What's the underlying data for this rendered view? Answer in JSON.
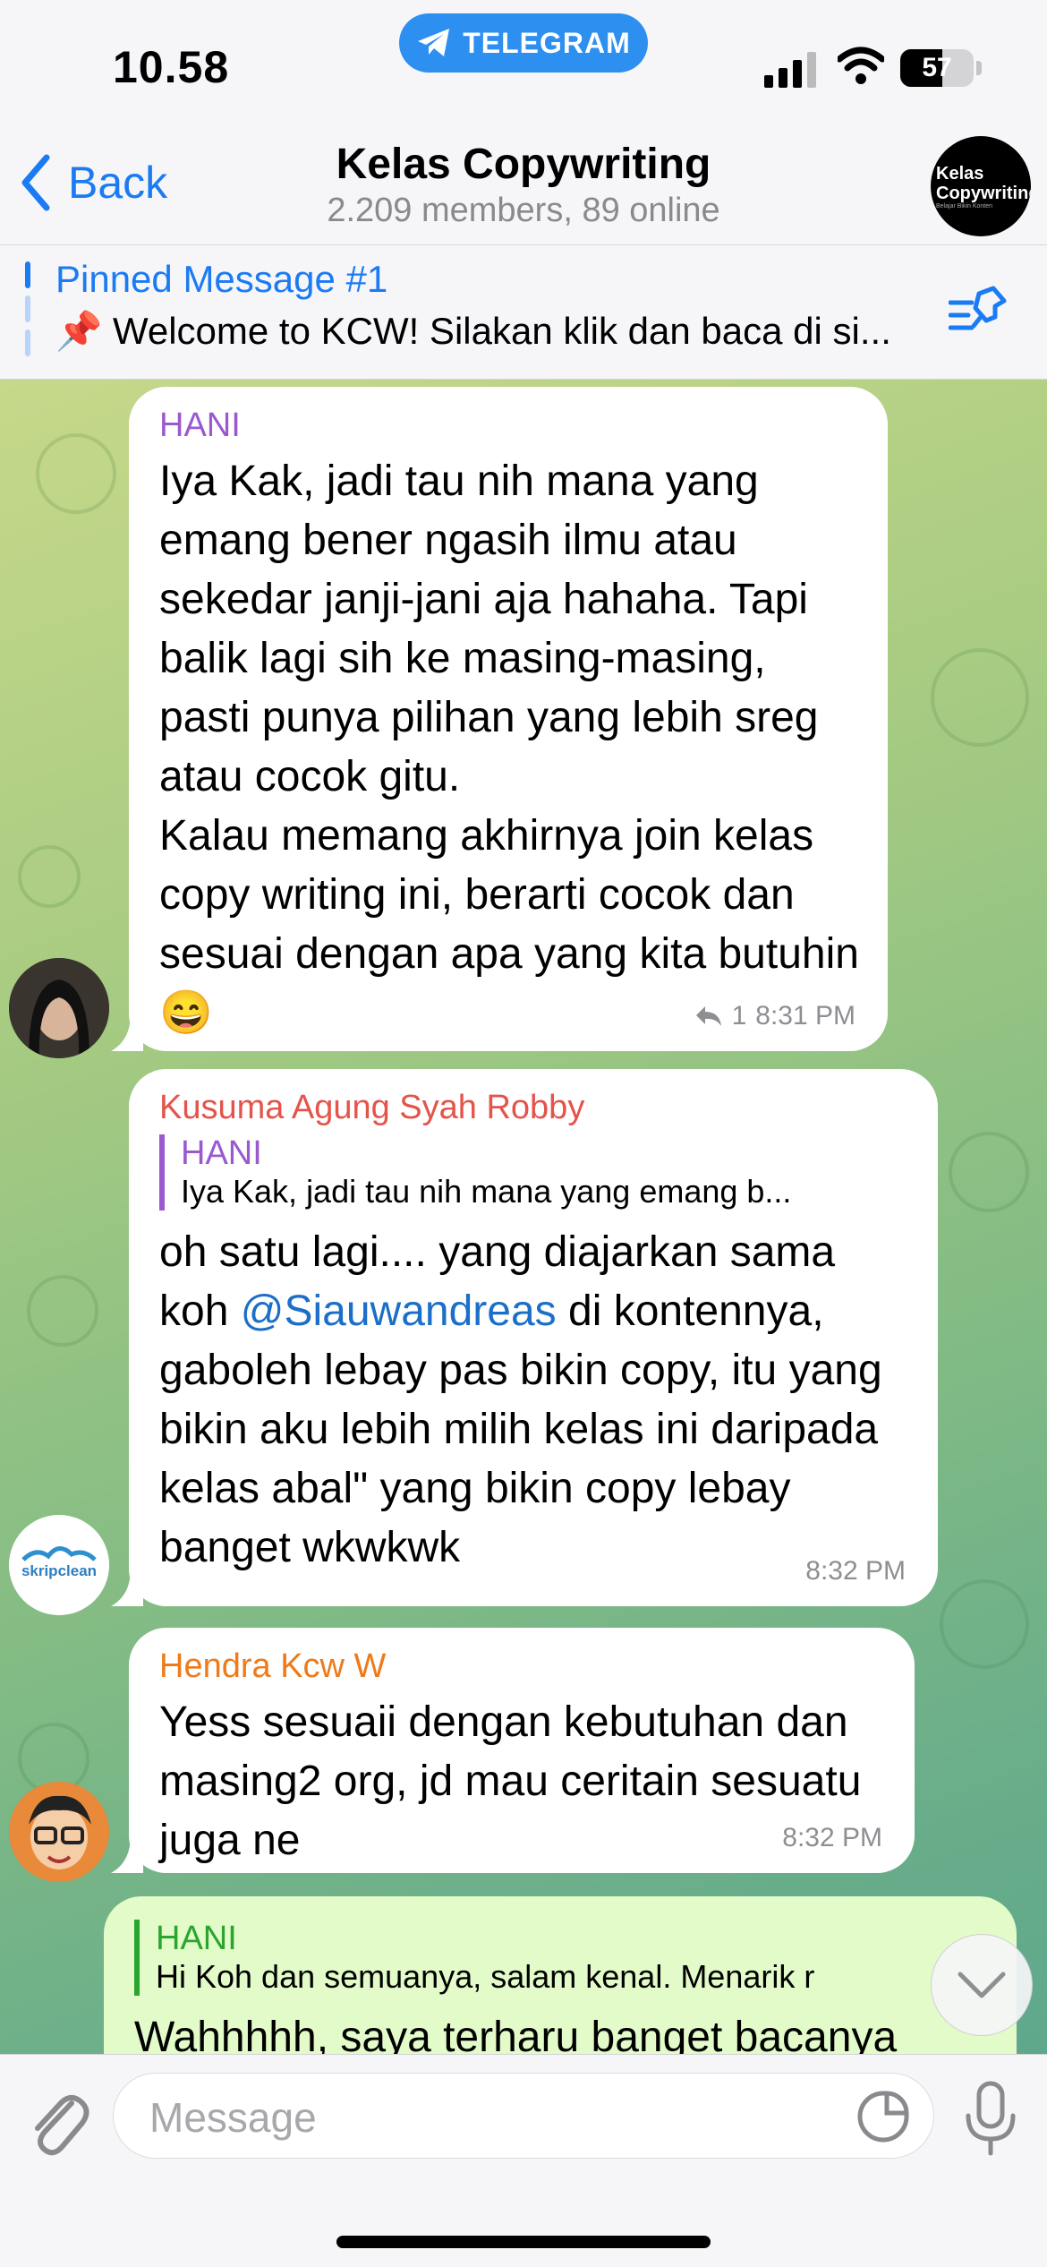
{
  "status": {
    "time": "10.58",
    "return_app": "TELEGRAM",
    "battery": "57",
    "battery_level": 0.57
  },
  "header": {
    "back_label": "Back",
    "title": "Kelas Copywriting",
    "subtitle": "2.209 members, 89 online",
    "avatar_line1": "Kelas",
    "avatar_line2": "Copywriting",
    "avatar_tagline": "Belajar Bikin Konten"
  },
  "pinned": {
    "title": "Pinned Message #1",
    "text": "📌 Welcome to KCW! Silakan klik dan baca di si..."
  },
  "messages": [
    {
      "sender": "HANI",
      "text": "Iya Kak, jadi tau nih mana yang emang bener ngasih ilmu atau sekedar janji-jani aja hahaha. Tapi balik lagi sih ke masing-masing, pasti punya pilihan yang lebih sreg atau cocok gitu.\nKalau memang akhirnya join kelas copy writing ini, berarti cocok dan sesuai dengan apa yang kita butuhin 😄",
      "replies": "1",
      "time": "8:31 PM"
    },
    {
      "sender": "Kusuma Agung Syah Robby",
      "quote_name": "HANI",
      "quote_text": "Iya Kak, jadi tau nih mana yang emang b...",
      "text_before": "oh satu lagi.... yang diajarkan sama koh ",
      "mention": "@Siauwandreas",
      "text_after": " di kontennya, gaboleh lebay pas bikin copy, itu yang bikin aku lebih milih kelas ini daripada kelas abal\" yang bikin copy lebay banget wkwkwk",
      "time": "8:32 PM",
      "avatar_text": "skripclean"
    },
    {
      "sender": "Hendra Kcw W",
      "text": "Yess sesuaii dengan kebutuhan dan masing2 org, jd mau ceritain sesuatu juga ne",
      "time": "8:32 PM"
    },
    {
      "quote_name": "HANI",
      "quote_text": "Hi Koh dan semuanya, salam kenal. Menarik r",
      "text": "Wahhhhh, saya terharu banget bacanya"
    }
  ],
  "input": {
    "placeholder": "Message"
  },
  "colors": {
    "accent": "#1b7bf3",
    "hani": "#9b59d0",
    "kusuma": "#e5534b",
    "hendra": "#ef7a1a",
    "out_quote": "#2aa52e"
  }
}
